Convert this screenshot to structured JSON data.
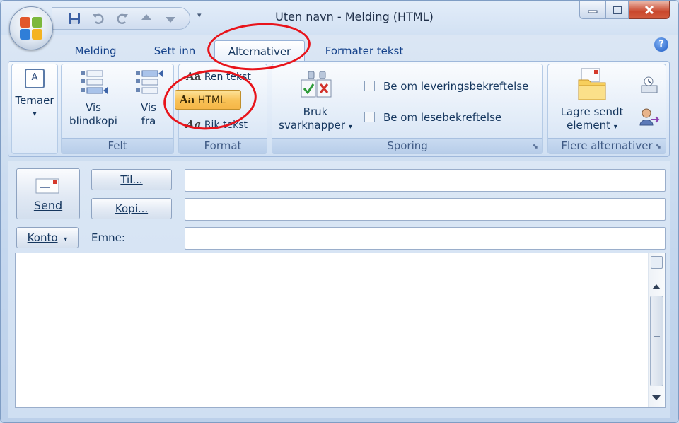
{
  "window": {
    "title": "Uten navn - Melding (HTML)"
  },
  "tabs": [
    {
      "label": "Melding"
    },
    {
      "label": "Sett inn"
    },
    {
      "label": "Alternativer"
    },
    {
      "label": "Formater tekst"
    }
  ],
  "active_tab": "Alternativer",
  "help_label": "?",
  "ribbon": {
    "themes": {
      "label": "Temaer"
    },
    "felt": {
      "label": "Felt",
      "vis_blindkopi_1": "Vis",
      "vis_blindkopi_2": "blindkopi",
      "vis_fra_1": "Vis",
      "vis_fra_2": "fra"
    },
    "format": {
      "label": "Format",
      "ren_tekst": "Ren tekst",
      "html": "HTML",
      "rik_tekst": "Rik tekst",
      "aa": "Aa"
    },
    "sporing": {
      "label": "Sporing",
      "bruk_1": "Bruk",
      "bruk_2": "svarknapper",
      "leveringsbekreftelse": "Be om leveringsbekreftelse",
      "lesebekreftelse": "Be om lesebekreftelse"
    },
    "flere": {
      "label": "Flere alternativer",
      "lagre_1": "Lagre sendt",
      "lagre_2": "element"
    }
  },
  "compose": {
    "send_label": "Send",
    "til_label": "Til...",
    "kopi_label": "Kopi...",
    "konto_label": "Konto",
    "emne_label": "Emne:",
    "til_value": "",
    "kopi_value": "",
    "emne_value": "",
    "body_value": ""
  },
  "colors": {
    "highlight_ellipse": "#e8141b",
    "active_button": "#f8c156"
  }
}
